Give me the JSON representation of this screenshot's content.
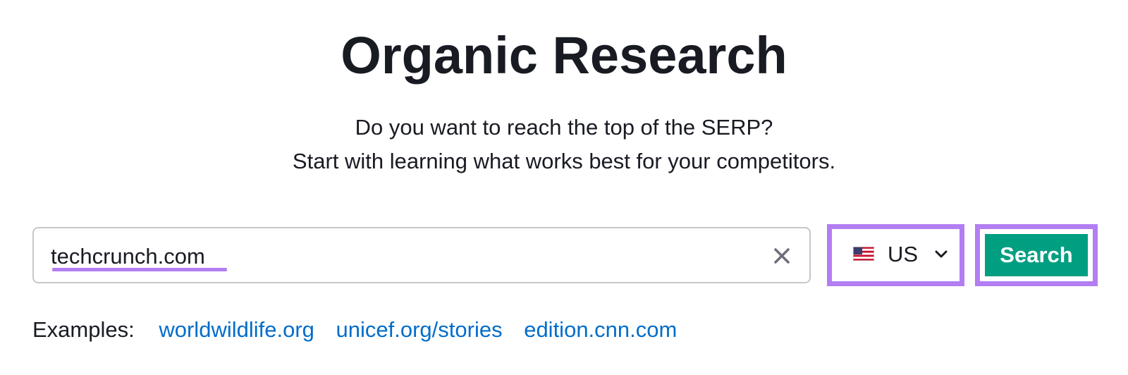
{
  "page": {
    "title": "Organic Research",
    "subtitle_line1": "Do you want to reach the top of the SERP?",
    "subtitle_line2": "Start with learning what works best for your competitors."
  },
  "search": {
    "value": "techcrunch.com",
    "clear_icon": "close-icon"
  },
  "database": {
    "flag_icon": "us-flag-icon",
    "selected": "US",
    "chevron_icon": "chevron-down-icon"
  },
  "search_button": {
    "label": "Search",
    "color": "#009f81"
  },
  "examples": {
    "label": "Examples:",
    "links": [
      "worldwildlife.org",
      "unicef.org/stories",
      "edition.cnn.com"
    ]
  },
  "colors": {
    "highlight": "#b27ef2",
    "link": "#006dca",
    "text": "#191b23"
  }
}
